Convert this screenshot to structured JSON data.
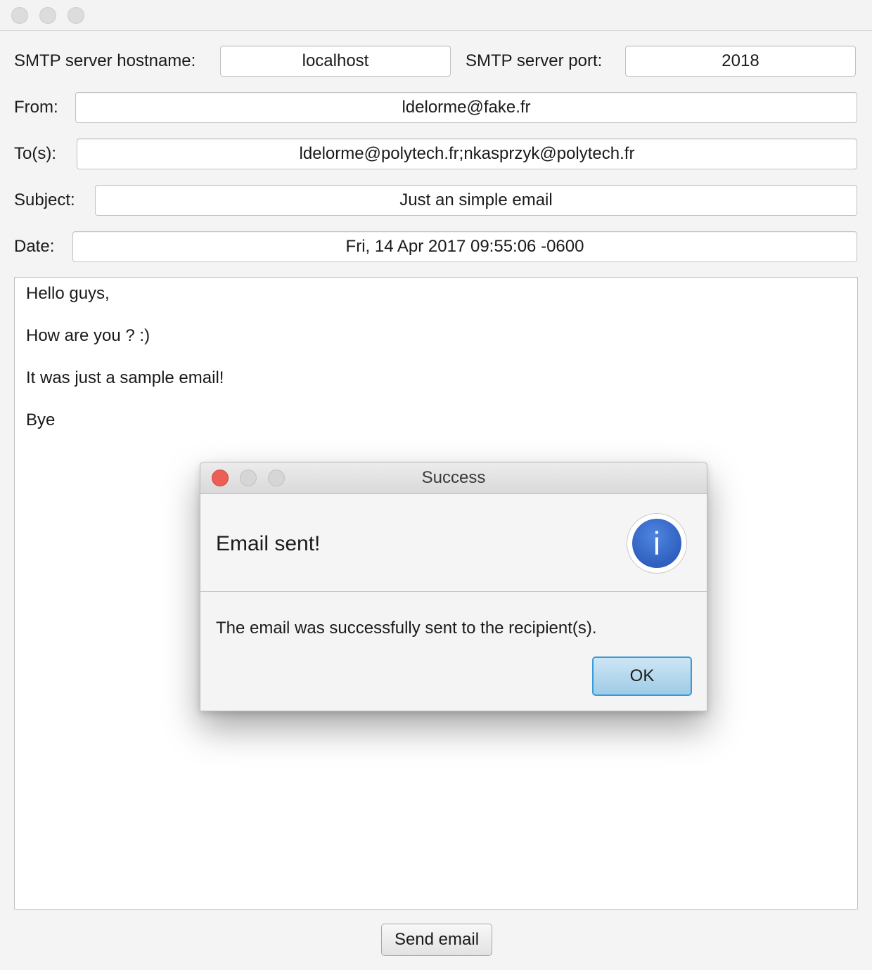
{
  "form": {
    "hostname_label": "SMTP server hostname:",
    "hostname_value": "localhost",
    "port_label": "SMTP server port:",
    "port_value": "2018",
    "from_label": "From:",
    "from_value": "ldelorme@fake.fr",
    "to_label": "To(s):",
    "to_value": "ldelorme@polytech.fr;nkasprzyk@polytech.fr",
    "subject_label": "Subject:",
    "subject_value": "Just an simple email",
    "date_label": "Date:",
    "date_value": "Fri, 14 Apr 2017 09:55:06 -0600"
  },
  "body_lines": [
    "Hello guys,",
    "How are you ? :)",
    "It was just a sample email!",
    "Bye"
  ],
  "send_button_label": "Send email",
  "dialog": {
    "title": "Success",
    "header": "Email sent!",
    "icon": "info-icon",
    "icon_glyph": "i",
    "content": "The email was successfully sent to the recipient(s).",
    "ok_label": "OK"
  },
  "colors": {
    "close_button": "#ec5f57",
    "ok_border": "#3a9ad9",
    "info_icon": "#2f5fbf"
  }
}
